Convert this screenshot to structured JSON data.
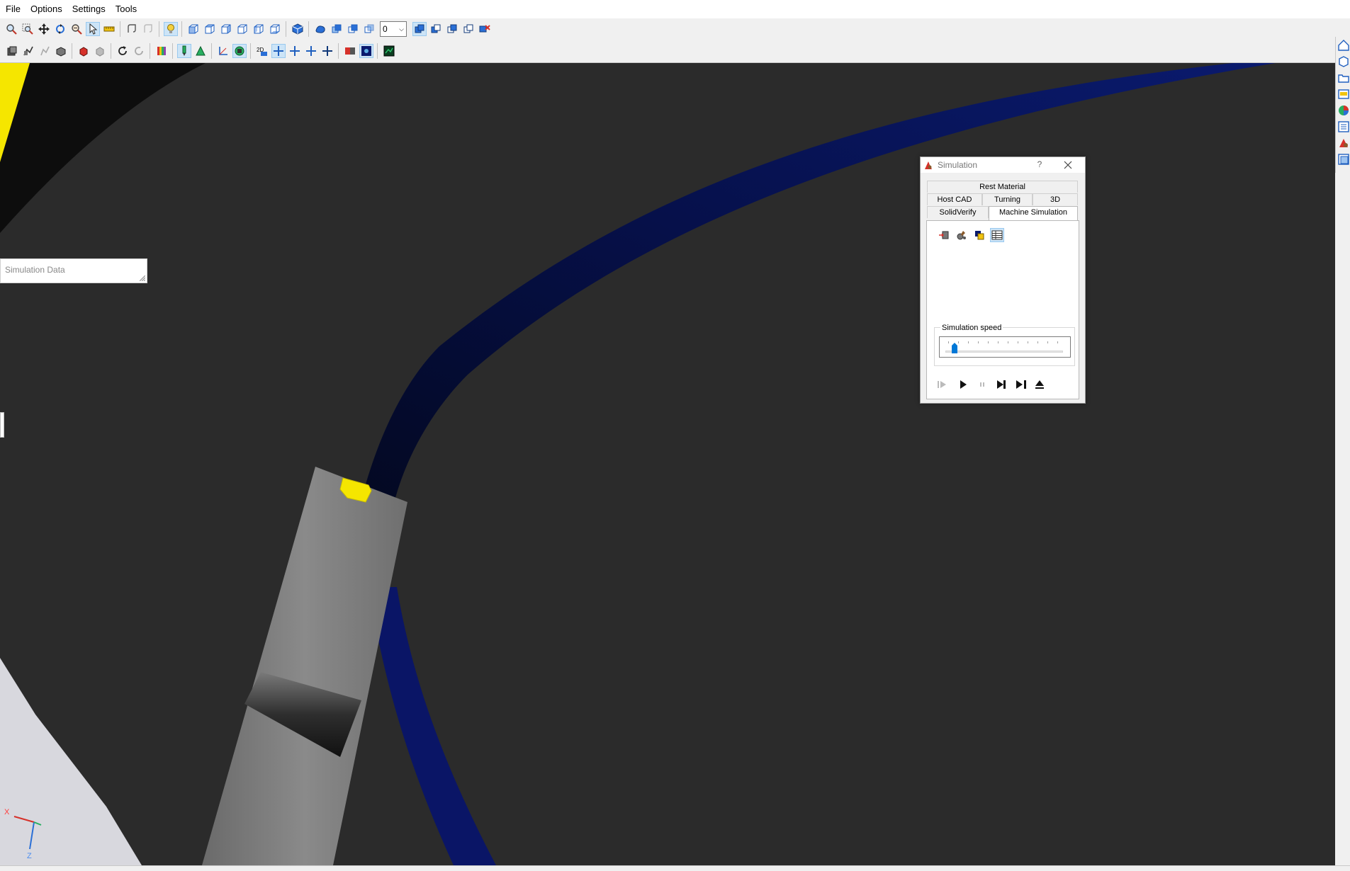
{
  "menu": [
    "File",
    "Options",
    "Settings",
    "Tools"
  ],
  "toolbar1": {
    "layer_value": "0"
  },
  "icons": {
    "toolbar1": [
      "zoom-icon",
      "zoom-window-icon",
      "pan-icon",
      "rotate-icon",
      "zoom-previous-icon",
      "select-pointer-icon",
      "measure-icon",
      "undo-view-icon",
      "redo-view-icon",
      "lightbulb-icon",
      "view-top-icon",
      "view-front-icon",
      "view-right-icon",
      "view-back-icon",
      "view-left-icon",
      "view-bottom-icon",
      "isometric-view-icon",
      "shaded-icon",
      "wireframe-icon",
      "hidden-line-icon",
      "transparent-icon",
      "display-mode-1-icon",
      "display-mode-2-icon",
      "display-mode-3-icon",
      "display-mode-4-icon",
      "machine-sim-icon"
    ],
    "toolbar2": [
      "model-icon",
      "toolpath-icon",
      "stock-icon",
      "fixture-icon",
      "tool-icon",
      "holder-icon",
      "refresh-icon",
      "reset-icon",
      "color-spectrum-icon",
      "tool-display-icon",
      "cone-icon",
      "axis-icon",
      "collision-icon",
      "2d-text-icon",
      "crosshair-1-icon",
      "crosshair-2-icon",
      "crosshair-3-icon",
      "crosshair-4-icon",
      "compare-icon",
      "analysis-icon",
      "monitor-icon"
    ],
    "right_toolbar": [
      "home-icon",
      "solid-icon",
      "folder-icon",
      "image-icon",
      "color-wheel-icon",
      "list-icon",
      "simulation-icon",
      "layout-icon"
    ]
  },
  "viewport": {
    "background": "#2b2b2b",
    "toolpath_color": "#0a1a6e",
    "tool_color": "#7a7a7a",
    "insert_color": "#f5e600"
  },
  "sim_data_panel": {
    "title": "Simulation Data"
  },
  "axis": {
    "x_label": "X",
    "z_label": "Z"
  },
  "simulation_dialog": {
    "title": "Simulation",
    "help": "?",
    "tabs_row1": [
      "Rest Material"
    ],
    "tabs_row2": [
      "Host CAD",
      "Turning",
      "3D"
    ],
    "tabs_row3": [
      "SolidVerify",
      "Machine Simulation"
    ],
    "active_tab": "Machine Simulation",
    "page_icons": [
      "machine-import-icon",
      "tool-library-icon",
      "layers-icon",
      "data-table-icon"
    ],
    "speed_label": "Simulation speed",
    "speed_value": 0.05,
    "controls": [
      "rewind-icon",
      "play-icon",
      "pause-icon",
      "step-forward-icon",
      "play-to-end-icon",
      "eject-icon"
    ]
  },
  "statusbar": {}
}
